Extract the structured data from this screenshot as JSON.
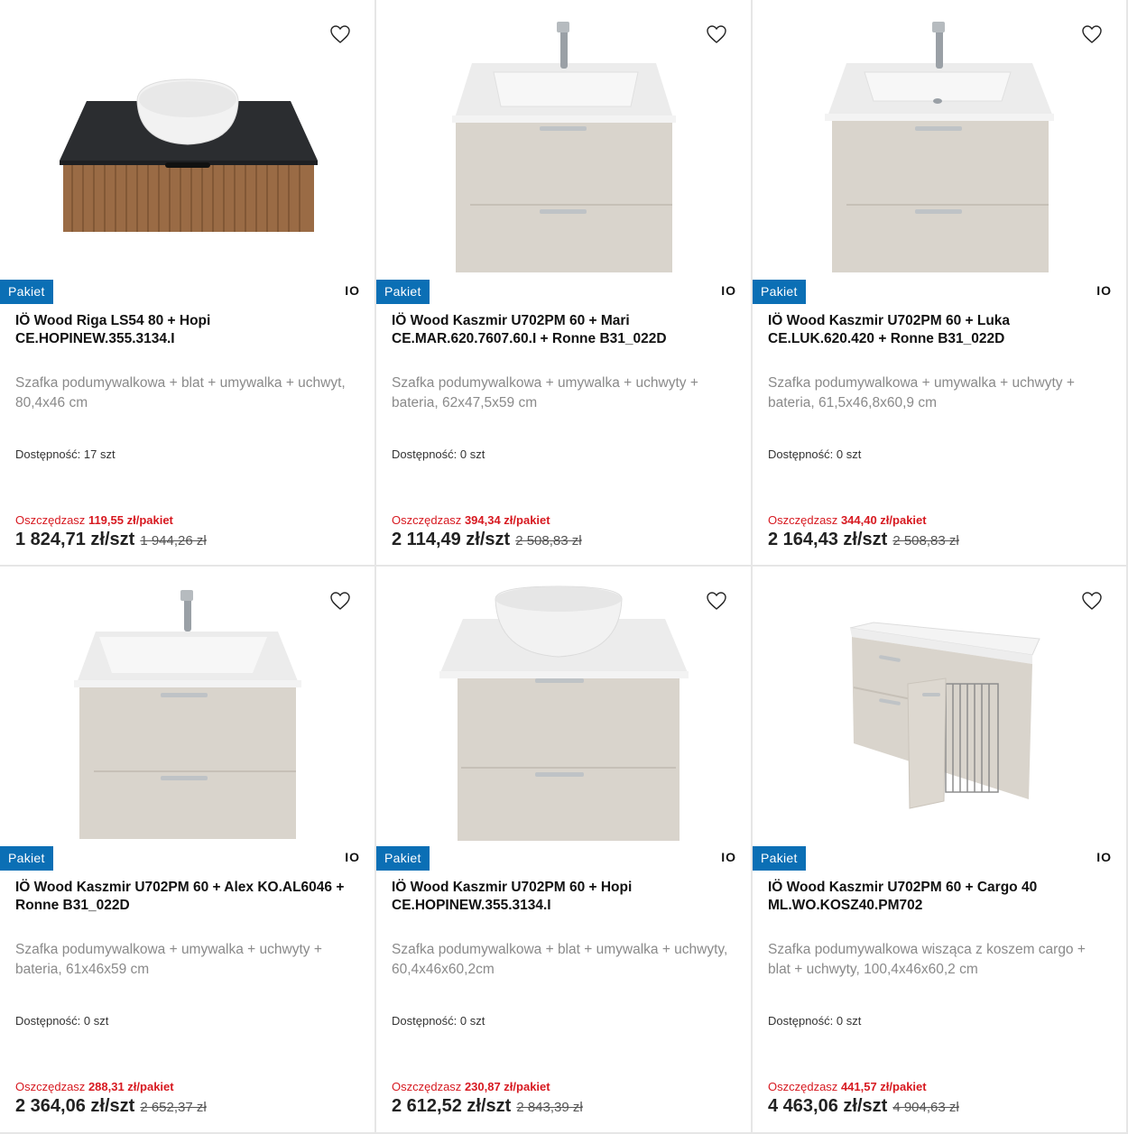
{
  "products": [
    {
      "badge": "Pakiet",
      "brand": "IO",
      "title": "IÖ Wood Riga LS54 80 + Hopi CE.HOPINEW.355.3134.I",
      "description": "Szafka podumywalkowa + blat + umywalka + uchwyt, 80,4x46 cm",
      "availability_label": "Dostępność:",
      "availability_value": "17 szt",
      "savings_label": "Oszczędzasz",
      "savings_value": "119,55 zł/pakiet",
      "price": "1 824,71 zł/szt",
      "old_price": "1 944,26 zł",
      "image": "vanity-wood-black-top-bowl"
    },
    {
      "badge": "Pakiet",
      "brand": "IO",
      "title": "IÖ Wood Kaszmir U702PM 60 + Mari CE.MAR.620.7607.60.I + Ronne B31_022D",
      "description": "Szafka podumywalkowa + umywalka + uchwyty + bateria, 62x47,5x59 cm",
      "availability_label": "Dostępność:",
      "availability_value": "0 szt",
      "savings_label": "Oszczędzasz",
      "savings_value": "394,34 zł/pakiet",
      "price": "2 114,49 zł/szt",
      "old_price": "2 508,83 zł",
      "image": "vanity-beige-integrated-sink"
    },
    {
      "badge": "Pakiet",
      "brand": "IO",
      "title": "IÖ Wood Kaszmir U702PM 60 + Luka CE.LUK.620.420 + Ronne B31_022D",
      "description": "Szafka podumywalkowa + umywalka + uchwyty + bateria, 61,5x46,8x60,9 cm",
      "availability_label": "Dostępność:",
      "availability_value": "0 szt",
      "savings_label": "Oszczędzasz",
      "savings_value": "344,40 zł/pakiet",
      "price": "2 164,43 zł/szt",
      "old_price": "2 508,83 zł",
      "image": "vanity-beige-integrated-sink"
    },
    {
      "badge": "Pakiet",
      "brand": "IO",
      "title": "IÖ Wood Kaszmir U702PM 60 + Alex KO.AL6046 + Ronne B31_022D",
      "description": "Szafka podumywalkowa + umywalka + uchwyty + bateria, 61x46x59 cm",
      "availability_label": "Dostępność:",
      "availability_value": "0 szt",
      "savings_label": "Oszczędzasz",
      "savings_value": "288,31 zł/pakiet",
      "price": "2 364,06 zł/szt",
      "old_price": "2 652,37 zł",
      "image": "vanity-beige-integrated-sink"
    },
    {
      "badge": "Pakiet",
      "brand": "IO",
      "title": "IÖ Wood Kaszmir U702PM 60 + Hopi CE.HOPINEW.355.3134.I",
      "description": "Szafka podumywalkowa + blat + umywalka + uchwyty, 60,4x46x60,2cm",
      "availability_label": "Dostępność:",
      "availability_value": "0 szt",
      "savings_label": "Oszczędzasz",
      "savings_value": "230,87 zł/pakiet",
      "price": "2 612,52 zł/szt",
      "old_price": "2 843,39 zł",
      "image": "vanity-beige-bowl"
    },
    {
      "badge": "Pakiet",
      "brand": "IO",
      "title": "IÖ Wood Kaszmir U702PM 60 + Cargo 40 ML.WO.KOSZ40.PM702",
      "description": "Szafka podumywalkowa wisząca z koszem cargo + blat + uchwyty, 100,4x46x60,2 cm",
      "availability_label": "Dostępność:",
      "availability_value": "0 szt",
      "savings_label": "Oszczędzasz",
      "savings_value": "441,57 zł/pakiet",
      "price": "4 463,06 zł/szt",
      "old_price": "4 904,63 zł",
      "image": "vanity-cargo-cabinet"
    }
  ],
  "colors": {
    "badge": "#0b6fb5",
    "savings": "#d71920",
    "cabinet_beige": "#d9d4cc"
  }
}
